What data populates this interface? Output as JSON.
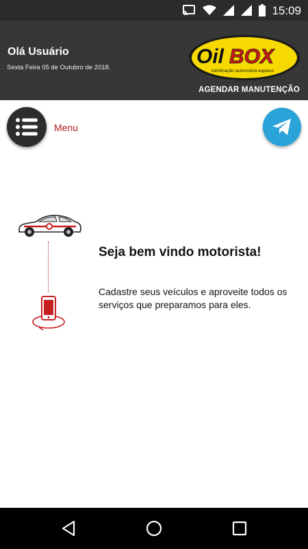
{
  "status_bar": {
    "time": "15:09",
    "icons": [
      "cast-icon",
      "wifi-icon",
      "signal-icon",
      "signal-icon-2",
      "battery-icon"
    ]
  },
  "header": {
    "greeting": "Olá Usuário",
    "date": "Sexta Feira 05 de Outubro de 2018.",
    "logo_text": "OilBOX",
    "logo_subtitle": "lubrificação automotiva express",
    "schedule_link": "AGENDAR MANUTENÇÃO"
  },
  "menu": {
    "label": "Menu"
  },
  "welcome": {
    "title": "Seja bem vindo motorista!",
    "text": "Cadastre seus veículos e aproveite todos os serviços que preparamos para eles."
  },
  "colors": {
    "accent_red": "#c61f1f",
    "menu_label": "#b01818",
    "telegram_blue": "#29a3d8",
    "logo_yellow": "#f5d900"
  },
  "nav": {
    "buttons": [
      "back-icon",
      "home-icon",
      "recents-icon"
    ]
  }
}
